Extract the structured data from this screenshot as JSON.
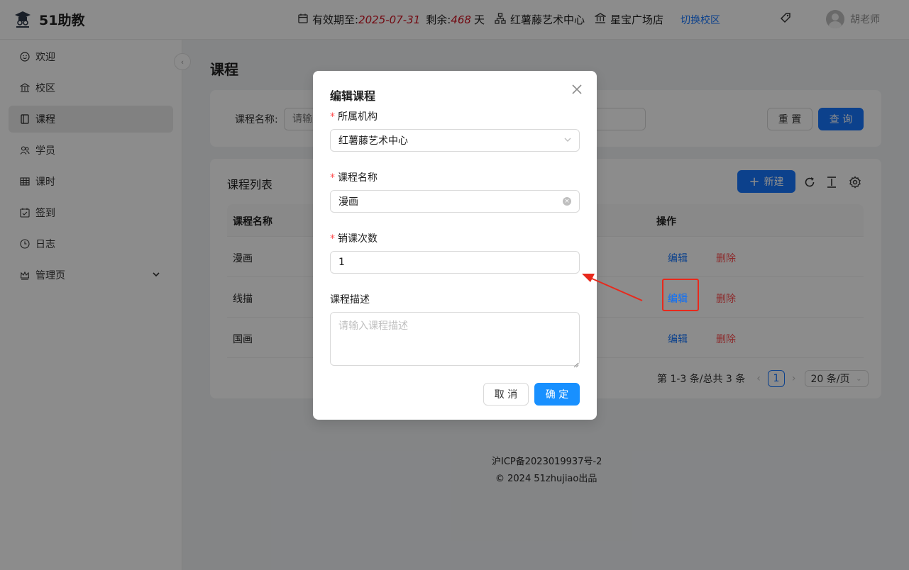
{
  "header": {
    "logo_text": "51助教",
    "validity_label": "有效期至:",
    "validity_date": "2025-07-31",
    "remaining_label": "剩余:",
    "remaining_days": "468",
    "days_unit": "天",
    "org_name": "红薯藤艺术中心",
    "campus_name": "星宝广场店",
    "switch_campus": "切换校区",
    "user_name": "胡老师"
  },
  "sidebar": {
    "items": [
      {
        "label": "欢迎",
        "icon": "smile-icon"
      },
      {
        "label": "校区",
        "icon": "bank-icon"
      },
      {
        "label": "课程",
        "icon": "book-icon"
      },
      {
        "label": "学员",
        "icon": "team-icon"
      },
      {
        "label": "课时",
        "icon": "table-icon"
      },
      {
        "label": "签到",
        "icon": "calendar-check-icon"
      },
      {
        "label": "日志",
        "icon": "clock-icon"
      },
      {
        "label": "管理页",
        "icon": "crown-icon"
      }
    ]
  },
  "main": {
    "page_title": "课程",
    "search": {
      "label": "课程名称:",
      "placeholder": "请输入",
      "reset_label": "重 置",
      "query_label": "查 询"
    },
    "table": {
      "title": "课程列表",
      "new_label": "新建",
      "headers": [
        "课程名称",
        "操作"
      ],
      "rows": [
        {
          "name": "漫画",
          "edit": "编辑",
          "delete": "删除"
        },
        {
          "name": "线描",
          "edit": "编辑",
          "delete": "删除"
        },
        {
          "name": "国画",
          "edit": "编辑",
          "delete": "删除"
        }
      ],
      "pager": {
        "summary": "第 1-3 条/总共 3 条",
        "current_page": "1",
        "page_size": "20 条/页"
      }
    }
  },
  "footer": {
    "icp": "沪ICP备2023019937号-2",
    "copyright": "2024 51zhujiao出品"
  },
  "modal": {
    "title": "编辑课程",
    "org_label": "所属机构",
    "org_value": "红薯藤艺术中心",
    "name_label": "课程名称",
    "name_value": "漫画",
    "count_label": "销课次数",
    "count_value": "1",
    "desc_label": "课程描述",
    "desc_placeholder": "请输入课程描述",
    "cancel_label": "取 消",
    "ok_label": "确 定"
  },
  "colors": {
    "primary": "#1677ff",
    "danger": "#ff4d4f",
    "annotation_red": "#e8291c",
    "validity_red": "#cf1322"
  }
}
